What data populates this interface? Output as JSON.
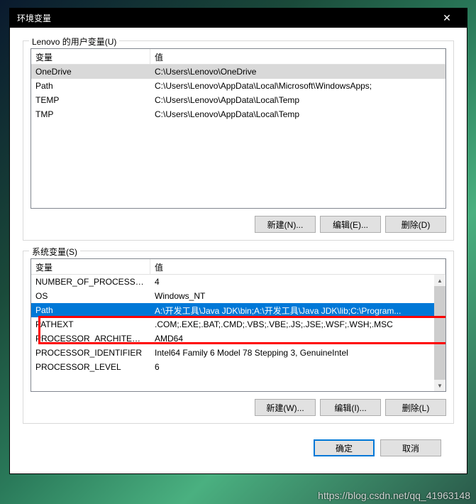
{
  "window": {
    "title": "环境变量",
    "close_glyph": "✕"
  },
  "user_vars": {
    "legend": "Lenovo 的用户变量(U)",
    "col_var": "变量",
    "col_val": "值",
    "rows": [
      {
        "name": "OneDrive",
        "value": "C:\\Users\\Lenovo\\OneDrive"
      },
      {
        "name": "Path",
        "value": "C:\\Users\\Lenovo\\AppData\\Local\\Microsoft\\WindowsApps;"
      },
      {
        "name": "TEMP",
        "value": "C:\\Users\\Lenovo\\AppData\\Local\\Temp"
      },
      {
        "name": "TMP",
        "value": "C:\\Users\\Lenovo\\AppData\\Local\\Temp"
      }
    ],
    "btn_new": "新建(N)...",
    "btn_edit": "编辑(E)...",
    "btn_delete": "删除(D)"
  },
  "sys_vars": {
    "legend": "系统变量(S)",
    "col_var": "变量",
    "col_val": "值",
    "rows": [
      {
        "name": "NUMBER_OF_PROCESSORS",
        "value": "4"
      },
      {
        "name": "OS",
        "value": "Windows_NT"
      },
      {
        "name": "Path",
        "value": "A:\\开发工具\\Java JDK\\bin;A:\\开发工具\\Java JDK\\lib;C:\\Program...",
        "active": true
      },
      {
        "name": "PATHEXT",
        "value": ".COM;.EXE;.BAT;.CMD;.VBS;.VBE;.JS;.JSE;.WSF;.WSH;.MSC"
      },
      {
        "name": "PROCESSOR_ARCHITECT...",
        "value": "AMD64"
      },
      {
        "name": "PROCESSOR_IDENTIFIER",
        "value": "Intel64 Family 6 Model 78 Stepping 3, GenuineIntel"
      },
      {
        "name": "PROCESSOR_LEVEL",
        "value": "6"
      }
    ],
    "btn_new": "新建(W)...",
    "btn_edit": "编辑(I)...",
    "btn_delete": "删除(L)"
  },
  "footer": {
    "ok": "确定",
    "cancel": "取消"
  },
  "watermark": "https://blog.csdn.net/qq_41963148"
}
